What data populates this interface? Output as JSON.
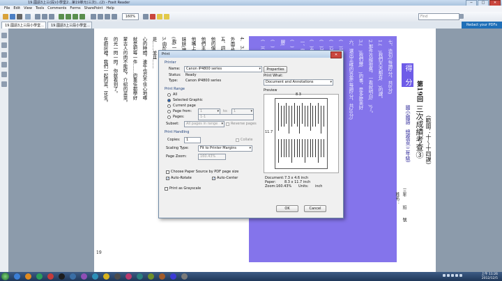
{
  "window": {
    "title": "19.國語3上三(段)小學堂2...第19單元(三次)...(2) - Foxit Reader",
    "controls": [
      "─",
      "□",
      "✕"
    ]
  },
  "menu": [
    "File",
    "Edit",
    "View",
    "Tools",
    "Comments",
    "Forms",
    "SharePoint",
    "Help"
  ],
  "toolbar": {
    "zoom_value": "160%",
    "find_placeholder": "Find"
  },
  "tabs": [
    {
      "label": "19.國語3上三段小學堂..."
    },
    {
      "label": "19.國語3上三段小學堂..."
    }
  ],
  "redact_banner": "Redact your PDFs",
  "document": {
    "page_number": "19",
    "left_columns": [
      "4.　3.　2.　1.　　　四、",
      "外面正颳著大風，最好別出門。",
      "五、詞語使用正確的打V(每題2分，共8分)",
      "他的個性自私，最喜歡(服務)大家。",
      "他們主人徬徨的樣子，真令人同情。",
      "他嘴上說吃東西，閣若於日常(關心)",
      "妹妹(嚼)著棒棒糖，(開心)的笑著。",
      "(我)一一看見陳公館的燈光，大家都在",
      "3.由於……因此…　　2.如果……就……",
      "是……並且……",
      "心的時間，連牛也忍不住心地啄",
      "就是把每一件……的重任都學好",
      "蒙古人的肉不能吃，介紹的菜菜。",
      "的光一閃一閃，你就看到了。",
      "在廚房裡，我們一起的菜、花生。"
    ],
    "blue_columns": [
      "七、造句(每題2分，共8分)",
      "1.(　)我們天天都有(　)的課。",
      "2.那件衣服很舊，一看就明白(　)了。",
      "3.(　)我們幾(　)的事，是多麼美好",
      "六、選出正確的答案(每題2分，共20分)",
      "(　)1.下列哪個詞語正確？①自以為 ②以為",
      "(　)2.哪一個字不是形聲字？①睛 ②晴",
      "(　)3.「張」的部首是？①弓 ②長",
      "(　)4.下列哪一組是同義詞？①舉 ②擇",
      "一、寫國字(每格2分，共20分)",
      "(　)　　(　)　　(　)",
      "醒(　)的　　走(　)　淺(　)",
      "(　)　　(　)　　(　)",
      "(　)(　)　　(　)(　)"
    ],
    "title_block": {
      "score_label": "得　分",
      "unit": "第19回",
      "series": "國小國語　總複習(三年級)",
      "test_name": "三次成績考查③",
      "range": "(範圍：十～十四課)",
      "fields": [
        "三年　　班　　號",
        "姓名："
      ]
    }
  },
  "print_dialog": {
    "title": "Print",
    "printer": {
      "group": "Printer",
      "name_label": "Name:",
      "name_value": "Canon iP4800 series",
      "properties_button": "Properties",
      "status_label": "Status:",
      "status_value": "Ready",
      "type_label": "Type:",
      "type_value": "Canon iP4800 series"
    },
    "print_what": {
      "label": "Print What:",
      "value": "Document and Annotations"
    },
    "print_range": {
      "group": "Print Range",
      "options": [
        "All",
        "Selected Graphic",
        "Current page",
        "Page from:",
        "Pages:"
      ],
      "selected_index": 1,
      "from_value": "1",
      "to_label": "to:",
      "to_value": "1",
      "pages_value": "1-1",
      "subset_label": "Subset:",
      "subset_value": "All pages in range",
      "reverse_label": "Reverse pages"
    },
    "print_handling": {
      "group": "Print Handling",
      "copies_label": "Copies:",
      "copies_value": "1",
      "collate_label": "Collate",
      "scaling_label": "Scaling Type:",
      "scaling_value": "Fit to Printer Margins",
      "zoom_label": "Page Zoom:",
      "zoom_value": "160.43%",
      "choose_source_label": "Choose Paper Source by PDF page size",
      "auto_rotate_label": "Auto-Rotate",
      "auto_center_label": "Auto-Center",
      "grayscale_label": "Print as Grayscale"
    },
    "preview": {
      "label": "Preview",
      "width_dim": "8.3",
      "height_dim": "11.7",
      "document_label": "Document:",
      "document_value": "7.3 x 4.6 inch",
      "paper_label": "Paper:",
      "paper_value": "8.3 x 11.7 inch",
      "zoom_label": "Zoom:",
      "zoom_value": "160.43%",
      "units_label": "Units:",
      "units_value": "inch"
    },
    "ok_button": "OK",
    "cancel_button": "Cancel",
    "close_glyph": "✕"
  },
  "taskbar": {
    "time": "上午 11:26",
    "date": "2012/12/5"
  },
  "colors": {
    "highlight": "#6e5ce8",
    "titlebar": "#b9d0ea",
    "taskbar": "#1f3758",
    "redact_banner": "#1f6fb8"
  }
}
